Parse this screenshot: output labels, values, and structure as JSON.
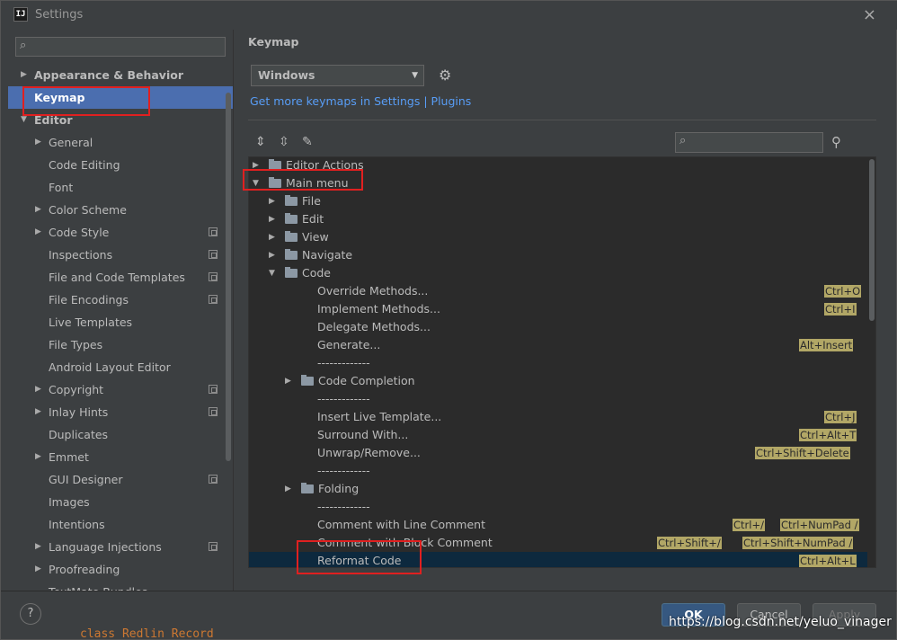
{
  "window": {
    "title": "Settings",
    "close_glyph": "×"
  },
  "sidebar": {
    "search_placeholder": "",
    "items": [
      {
        "label": "Appearance & Behavior"
      },
      {
        "label": "Keymap"
      },
      {
        "label": "Editor"
      },
      {
        "label": "General"
      },
      {
        "label": "Code Editing"
      },
      {
        "label": "Font"
      },
      {
        "label": "Color Scheme"
      },
      {
        "label": "Code Style"
      },
      {
        "label": "Inspections"
      },
      {
        "label": "File and Code Templates"
      },
      {
        "label": "File Encodings"
      },
      {
        "label": "Live Templates"
      },
      {
        "label": "File Types"
      },
      {
        "label": "Android Layout Editor"
      },
      {
        "label": "Copyright"
      },
      {
        "label": "Inlay Hints"
      },
      {
        "label": "Duplicates"
      },
      {
        "label": "Emmet"
      },
      {
        "label": "GUI Designer"
      },
      {
        "label": "Images"
      },
      {
        "label": "Intentions"
      },
      {
        "label": "Language Injections"
      },
      {
        "label": "Proofreading"
      },
      {
        "label": "TextMate Bundles"
      }
    ]
  },
  "main": {
    "heading": "Keymap",
    "scheme_value": "Windows",
    "link_text": "Get more keymaps in Settings | Plugins",
    "tree": [
      {
        "label": "Editor Actions",
        "shortcuts": []
      },
      {
        "label": "Main menu",
        "shortcuts": []
      },
      {
        "label": "File",
        "shortcuts": []
      },
      {
        "label": "Edit",
        "shortcuts": []
      },
      {
        "label": "View",
        "shortcuts": []
      },
      {
        "label": "Navigate",
        "shortcuts": []
      },
      {
        "label": "Code",
        "shortcuts": []
      },
      {
        "label": "Override Methods...",
        "shortcuts": [
          "Ctrl+O"
        ]
      },
      {
        "label": "Implement Methods...",
        "shortcuts": [
          "Ctrl+I"
        ]
      },
      {
        "label": "Delegate Methods...",
        "shortcuts": []
      },
      {
        "label": "Generate...",
        "shortcuts": [
          "Alt+Insert"
        ]
      },
      {
        "label": "-------------",
        "shortcuts": []
      },
      {
        "label": "Code Completion",
        "shortcuts": []
      },
      {
        "label": "-------------",
        "shortcuts": []
      },
      {
        "label": "Insert Live Template...",
        "shortcuts": [
          "Ctrl+J"
        ]
      },
      {
        "label": "Surround With...",
        "shortcuts": [
          "Ctrl+Alt+T"
        ]
      },
      {
        "label": "Unwrap/Remove...",
        "shortcuts": [
          "Ctrl+Shift+Delete"
        ]
      },
      {
        "label": "-------------",
        "shortcuts": []
      },
      {
        "label": "Folding",
        "shortcuts": []
      },
      {
        "label": "-------------",
        "shortcuts": []
      },
      {
        "label": "Comment with Line Comment",
        "shortcuts": [
          "Ctrl+/",
          "Ctrl+NumPad /"
        ]
      },
      {
        "label": "Comment with Block Comment",
        "shortcuts": [
          "Ctrl+Shift+/",
          "Ctrl+Shift+NumPad /"
        ]
      },
      {
        "label": "Reformat Code",
        "shortcuts": [
          "Ctrl+Alt+L"
        ]
      }
    ]
  },
  "footer": {
    "help": "?",
    "ok": "OK",
    "cancel": "Cancel",
    "apply": "Apply",
    "watermark": "https://blog.csdn.net/yeluo_vinager",
    "underlying_code": "class Redlin Record"
  },
  "colors": {
    "accent": "#4b6eaf",
    "highlight_box": "#e02020",
    "shortcut_badge": "#b2a766"
  }
}
